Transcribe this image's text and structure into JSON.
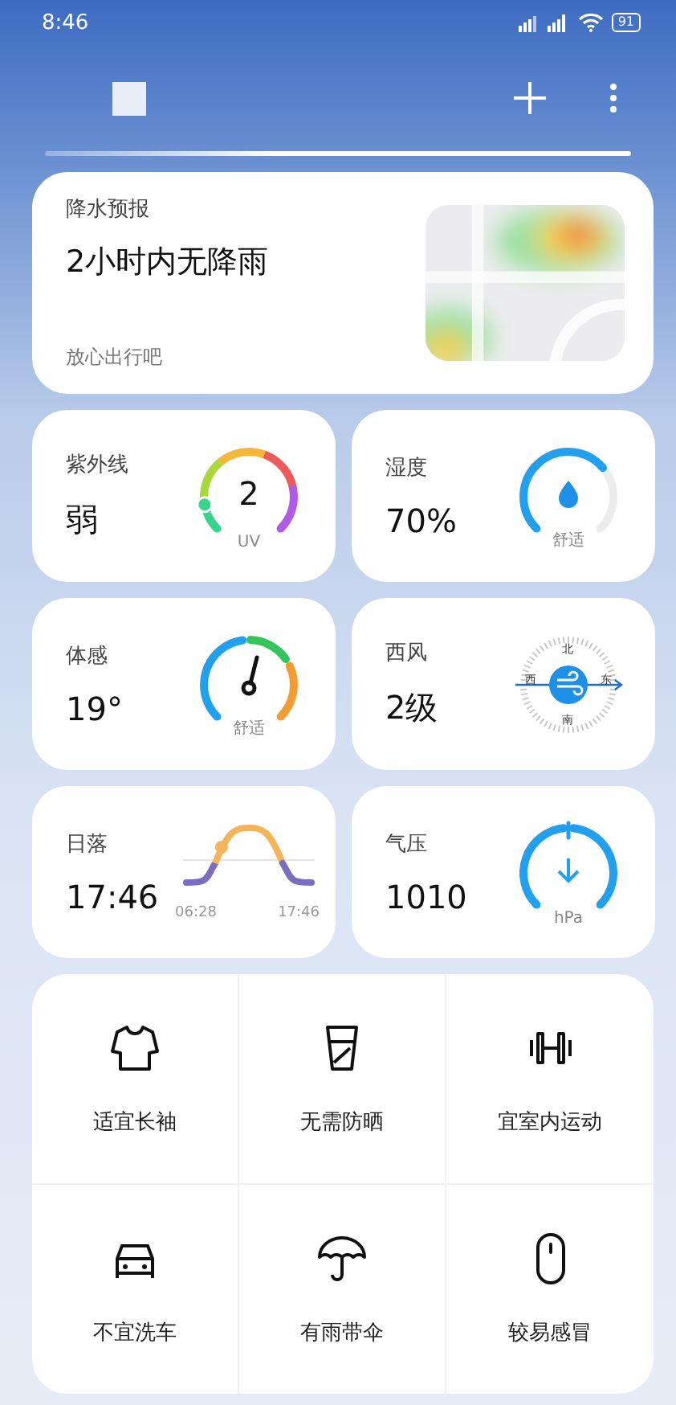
{
  "status_bar": {
    "time": "8:46",
    "battery": "91"
  },
  "precipitation": {
    "title": "降水预报",
    "headline": "2小时内无降雨",
    "note": "放心出行吧"
  },
  "tiles": [
    {
      "kind": "uv",
      "title": "紫外线",
      "value": "弱",
      "dial_value": "2",
      "dial_label": "UV"
    },
    {
      "kind": "humidity",
      "title": "湿度",
      "value": "70%",
      "dial_label": "舒适"
    },
    {
      "kind": "feels",
      "title": "体感",
      "value": "19°",
      "dial_label": "舒适"
    },
    {
      "kind": "wind",
      "title": "西风",
      "value": "2级",
      "compass": {
        "north": "北",
        "west": "西",
        "east": "东",
        "south": "南"
      }
    },
    {
      "kind": "sun",
      "title": "日落",
      "value": "17:46",
      "sunrise": "06:28",
      "sunset": "17:46"
    },
    {
      "kind": "pressure",
      "title": "气压",
      "value": "1010",
      "dial_label": "hPa"
    }
  ],
  "tips": [
    {
      "kind": "shirt",
      "label": "适宜长袖"
    },
    {
      "kind": "cup",
      "label": "无需防晒"
    },
    {
      "kind": "dumbbell",
      "label": "宜室内运动"
    },
    {
      "kind": "car",
      "label": "不宜洗车"
    },
    {
      "kind": "umbrella",
      "label": "有雨带伞"
    },
    {
      "kind": "pill",
      "label": "较易感冒"
    }
  ]
}
